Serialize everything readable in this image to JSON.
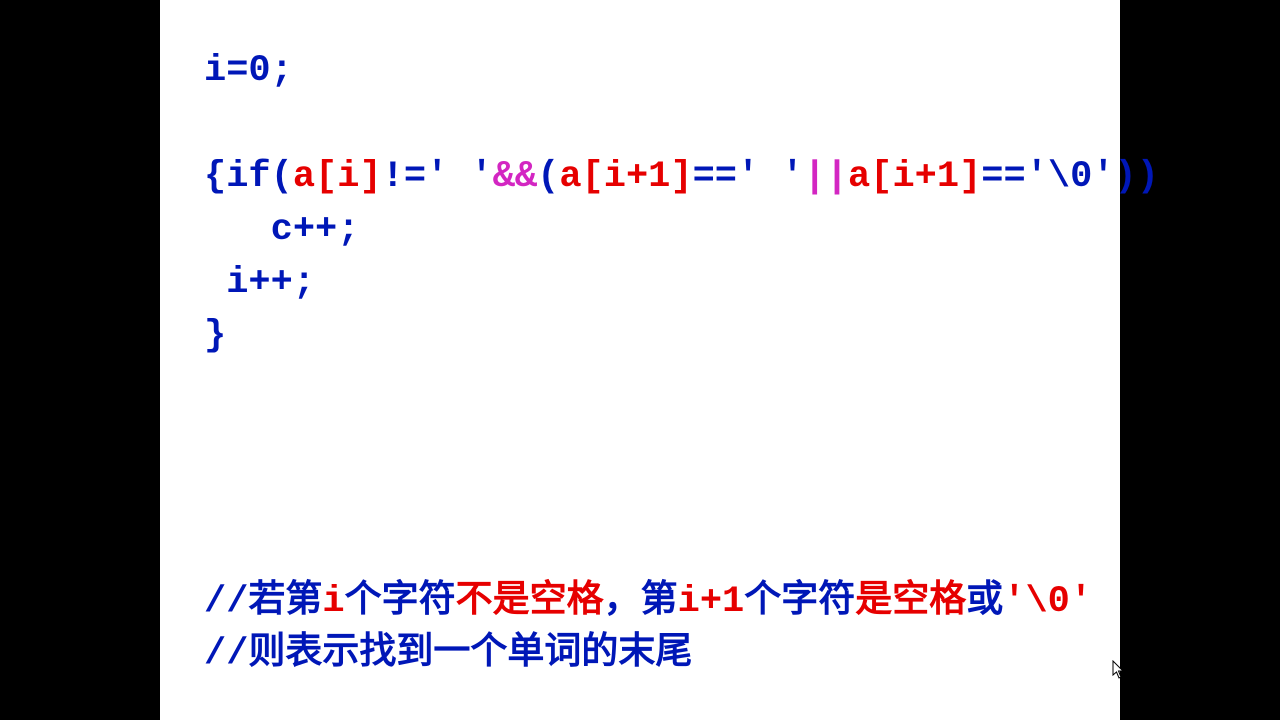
{
  "code": {
    "line1": "i=0;",
    "line2_open": "{",
    "line2_if": "if",
    "line2_paren1": "(",
    "line2_ai": "a[i]",
    "line2_neq": "!=' '",
    "line2_and": "&&",
    "line2_paren2": "(",
    "line2_ai1a": "a[i+1]",
    "line2_eq1": "==' '",
    "line2_or": "||",
    "line2_ai1b": "a[i+1]",
    "line2_eq2": "=='\\0'",
    "line2_close": "))",
    "line3": "   c++;",
    "line4": " i++;",
    "line5": "}"
  },
  "comment": {
    "l1_a": "//若第",
    "l1_b": "i",
    "l1_c": "个字符",
    "l1_d": "不是空格",
    "l1_e": "，第",
    "l1_f": "i+1",
    "l1_g": "个字符",
    "l1_h": "是空格",
    "l1_i": "或",
    "l1_j": "'\\0'",
    "l2": "//则表示找到一个单词的末尾"
  }
}
